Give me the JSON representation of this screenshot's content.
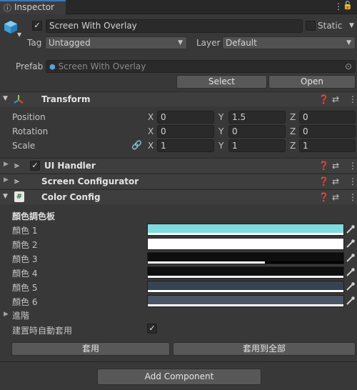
{
  "tab": {
    "title": "Inspector"
  },
  "object": {
    "name": "Screen With Overlay",
    "active_checked": true,
    "static_label": "Static",
    "tag_label": "Tag",
    "tag_value": "Untagged",
    "layer_label": "Layer",
    "layer_value": "Default",
    "prefab_label": "Prefab",
    "prefab_value": "Screen With Overlay",
    "select_label": "Select",
    "open_label": "Open"
  },
  "transform": {
    "title": "Transform",
    "position_label": "Position",
    "rotation_label": "Rotation",
    "scale_label": "Scale",
    "axis_x": "X",
    "axis_y": "Y",
    "axis_z": "Z",
    "position": {
      "x": "0",
      "y": "1.5",
      "z": "0"
    },
    "rotation": {
      "x": "0",
      "y": "0",
      "z": "0"
    },
    "scale": {
      "x": "1",
      "y": "1",
      "z": "1"
    }
  },
  "components": {
    "ui_handler": "UI Handler",
    "screen_configurator": "Screen Configurator",
    "color_config": "Color Config"
  },
  "color_config": {
    "palette_header": "顏色調色板",
    "colors": [
      {
        "label": "顏色 1",
        "hex": "#7fdbe0",
        "alpha": 1.0
      },
      {
        "label": "顏色 2",
        "hex": "#ffffff",
        "alpha": 1.0
      },
      {
        "label": "顏色 3",
        "hex": "#0e0e0e",
        "alpha": 0.6
      },
      {
        "label": "顏色 4",
        "hex": "#0e0e0e",
        "alpha": 1.0
      },
      {
        "label": "顏色 5",
        "hex": "#364352",
        "alpha": 1.0
      },
      {
        "label": "顏色 6",
        "hex": "#4c5566",
        "alpha": 1.0
      }
    ],
    "advanced_label": "進階",
    "auto_apply_label": "建置時自動套用",
    "auto_apply_checked": true,
    "apply_label": "套用",
    "apply_all_label": "套用到全部"
  },
  "footer": {
    "add_component_label": "Add Component"
  },
  "colors": {
    "bg": "#383838",
    "field": "#2a2a2a",
    "button": "#585858",
    "header": "#3e3e3e"
  }
}
